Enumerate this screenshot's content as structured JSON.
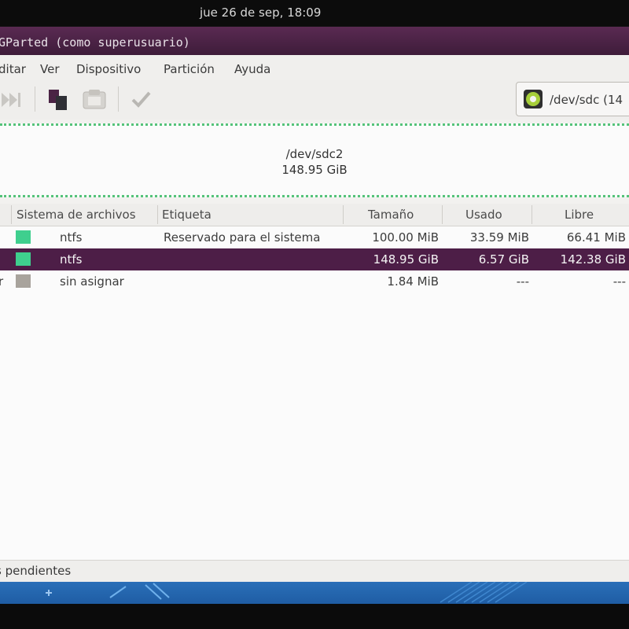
{
  "topbar": {
    "clock": "jue 26 de sep, 18:09"
  },
  "window": {
    "title": "GParted (como superusuario)",
    "menu": [
      "ditar",
      "Ver",
      "Dispositivo",
      "Partición",
      "Ayuda"
    ],
    "toolbar": {
      "icons": [
        "go-last-icon",
        "copy-icon",
        "paste-icon",
        "apply-icon"
      ],
      "device_label": "/dev/sdc  (14"
    },
    "disk_map": {
      "partition_name": "/dev/sdc2",
      "partition_size": "148.95 GiB"
    },
    "table": {
      "columns": [
        "Sistema de archivos",
        "Etiqueta",
        "Tamaño",
        "Usado",
        "Libre"
      ],
      "rows": [
        {
          "prefix": "",
          "fs": "ntfs",
          "label": "Reservado para el sistema",
          "size": "100.00 MiB",
          "used": "33.59 MiB",
          "free": "66.41 MiB",
          "color": "#3fcf8e",
          "selected": false
        },
        {
          "prefix": "",
          "fs": "ntfs",
          "label": "",
          "size": "148.95 GiB",
          "used": "6.57 GiB",
          "free": "142.38 GiB",
          "color": "#3fcf8e",
          "selected": true
        },
        {
          "prefix": "r",
          "fs": "sin asignar",
          "label": "",
          "size": "1.84 MiB",
          "used": "---",
          "free": "---",
          "color": "#a8a39c",
          "selected": false
        }
      ]
    },
    "status": "s pendientes"
  }
}
